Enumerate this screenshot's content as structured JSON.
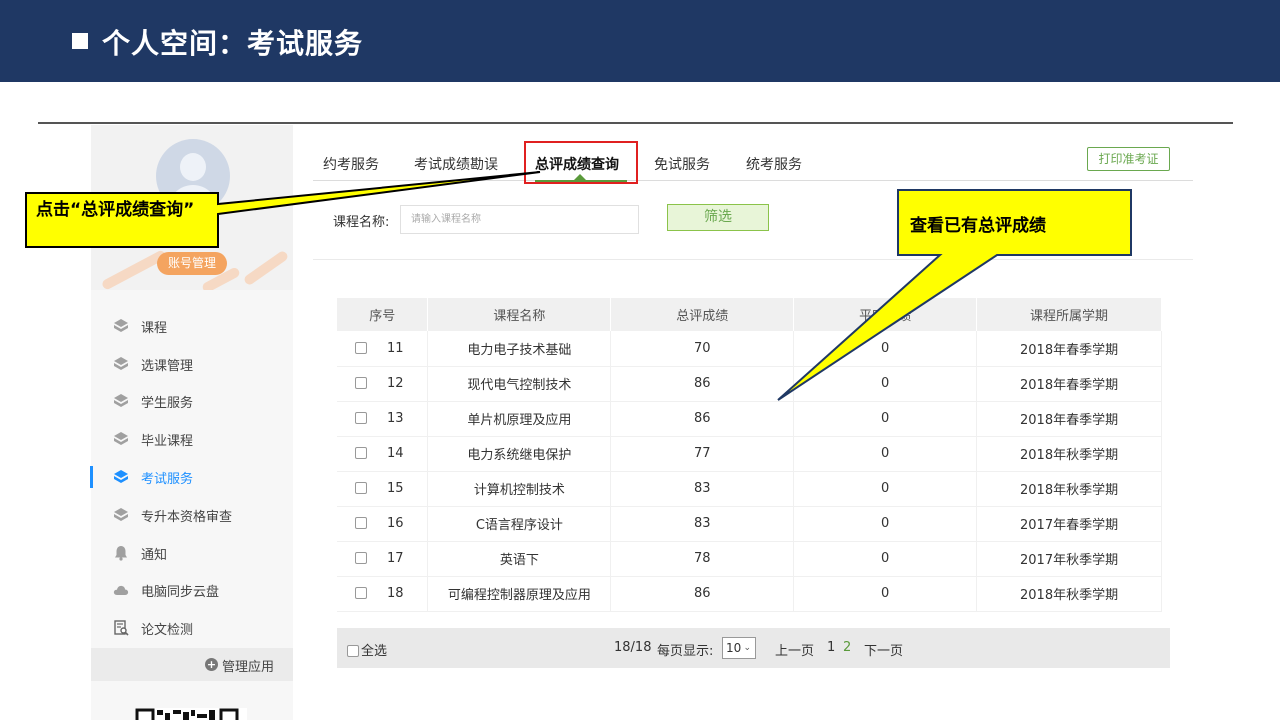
{
  "slide": {
    "title": "个人空间：考试服务"
  },
  "sidebar": {
    "account_button": "账号管理",
    "items": [
      {
        "label": "课程",
        "icon": "cube-icon"
      },
      {
        "label": "选课管理",
        "icon": "cube-icon"
      },
      {
        "label": "学生服务",
        "icon": "cube-icon"
      },
      {
        "label": "毕业课程",
        "icon": "cube-icon"
      },
      {
        "label": "考试服务",
        "icon": "cube-icon",
        "active": true
      },
      {
        "label": "专升本资格审查",
        "icon": "cube-icon"
      },
      {
        "label": "通知",
        "icon": "bell-icon"
      },
      {
        "label": "电脑同步云盘",
        "icon": "cloud-icon"
      },
      {
        "label": "论文检测",
        "icon": "document-search-icon"
      }
    ],
    "manage_apps": "管理应用"
  },
  "tabs": {
    "items": [
      "约考服务",
      "考试成绩勘误",
      "总评成绩查询",
      "免试服务",
      "统考服务"
    ],
    "active": "总评成绩查询",
    "print_button": "打印准考证"
  },
  "filter": {
    "label": "课程名称:",
    "placeholder": "请输入课程名称",
    "button": "筛选"
  },
  "table": {
    "columns": [
      "序号",
      "课程名称",
      "总评成绩",
      "平时成绩",
      "课程所属学期"
    ],
    "rows": [
      [
        "11",
        "电力电子技术基础",
        "70",
        "0",
        "2018年春季学期"
      ],
      [
        "12",
        "现代电气控制技术",
        "86",
        "0",
        "2018年春季学期"
      ],
      [
        "13",
        "单片机原理及应用",
        "86",
        "0",
        "2018年春季学期"
      ],
      [
        "14",
        "电力系统继电保护",
        "77",
        "0",
        "2018年秋季学期"
      ],
      [
        "15",
        "计算机控制技术",
        "83",
        "0",
        "2018年秋季学期"
      ],
      [
        "16",
        "C语言程序设计",
        "83",
        "0",
        "2017年春季学期"
      ],
      [
        "17",
        "英语下",
        "78",
        "0",
        "2017年秋季学期"
      ],
      [
        "18",
        "可编程控制器原理及应用",
        "86",
        "0",
        "2018年秋季学期"
      ]
    ]
  },
  "footer": {
    "select_all": "全选",
    "count": "18/18",
    "per_page_label": "每页显示:",
    "per_page_value": "10",
    "prev": "上一页",
    "page1": "1",
    "page2": "2",
    "next": "下一页"
  },
  "callouts": {
    "left": "点击“总评成绩查询”",
    "right": "查看已有总评成绩"
  },
  "colors": {
    "header_bg": "#1f3864",
    "accent_green": "#5a9a3b",
    "active_blue": "#1e90ff",
    "callout_yellow": "#ffff00",
    "highlight_red": "#e02020"
  }
}
